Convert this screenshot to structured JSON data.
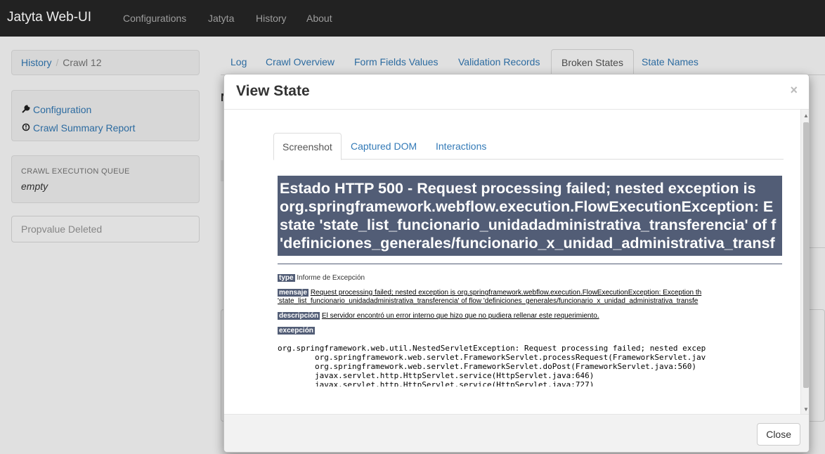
{
  "navbar": {
    "brand": "Jatyta Web-UI",
    "links": [
      "Configurations",
      "Jatyta",
      "History",
      "About"
    ]
  },
  "breadcrumb": {
    "history": "History",
    "separator": "/",
    "current": "Crawl 12"
  },
  "sidebar_links": [
    {
      "icon": "wrench-icon",
      "label": "Configuration"
    },
    {
      "icon": "info-circle-icon",
      "label": "Crawl Summary Report"
    }
  ],
  "queue": {
    "label": "CRAWL EXECUTION QUEUE",
    "value": "empty"
  },
  "prop_button": "Propvalue Deleted",
  "tabs": [
    "Log",
    "Crawl Overview",
    "Form Fields Values",
    "Validation Records",
    "Broken States",
    "State Names"
  ],
  "active_tab": "Broken States",
  "bg_heading_fragment": "N",
  "modal": {
    "title": "View State",
    "close_symbol": "×",
    "tabs": [
      "Screenshot",
      "Captured DOM",
      "Interactions"
    ],
    "active_tab": "Screenshot",
    "footer_button": "Close",
    "screenshot": {
      "title_lines": [
        "Estado HTTP 500 - Request processing failed; nested exception is",
        "org.springframework.webflow.execution.FlowExecutionException: E",
        "state 'state_list_funcionario_unidadadministrativa_transferencia' of f",
        "'definiciones_generales/funcionario_x_unidad_administrativa_transf"
      ],
      "type_tag": "type",
      "type_text": "Informe de Excepción",
      "mensaje_tag": "mensaje",
      "mensaje_line1": "Request processing failed; nested exception is org.springframework.webflow.execution.FlowExecutionException: Exception th",
      "mensaje_line2": "'state_list_funcionario_unidadadministrativa_transferencia' of flow 'definiciones_generales/funcionario_x_unidad_administrativa_transfe",
      "descripcion_tag": "descripción",
      "descripcion_text": "El servidor encontró un error interno que hizo que no pudiera rellenar este requerimiento.",
      "excepcion_tag": "excepción",
      "stack": "org.springframework.web.util.NestedServletException: Request processing failed; nested excep\n\torg.springframework.web.servlet.FrameworkServlet.processRequest(FrameworkServlet.jav\n\torg.springframework.web.servlet.FrameworkServlet.doPost(FrameworkServlet.java:560)\n\tjavax.servlet.http.HttpServlet.service(HttpServlet.java:646)\n\tjavax.servlet.http.HttpServlet.service(HttpServlet.java:727)"
    }
  }
}
